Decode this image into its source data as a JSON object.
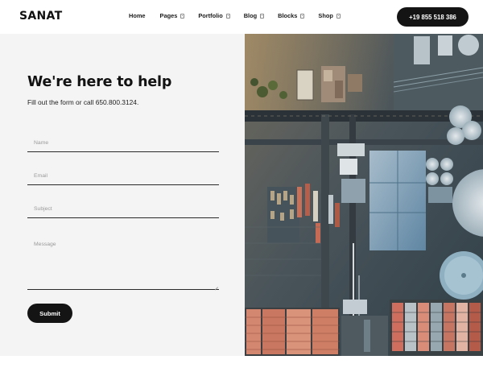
{
  "header": {
    "logo": "SANAT",
    "nav": [
      {
        "label": "Home",
        "has_dropdown": false
      },
      {
        "label": "Pages",
        "has_dropdown": true
      },
      {
        "label": "Portfolio",
        "has_dropdown": true
      },
      {
        "label": "Blog",
        "has_dropdown": true
      },
      {
        "label": "Blocks",
        "has_dropdown": true
      },
      {
        "label": "Shop",
        "has_dropdown": true
      }
    ],
    "phone_button": "+19 855 518 386"
  },
  "contact_form": {
    "title": "We're here to help",
    "subtitle": "Fill out the form or call 650.800.3124.",
    "fields": {
      "name_placeholder": "Name",
      "email_placeholder": "Email",
      "subject_placeholder": "Subject",
      "message_placeholder": "Message"
    },
    "submit_label": "Submit"
  },
  "colors": {
    "button_bg": "#141414",
    "panel_bg": "#f4f4f4",
    "text": "#121212"
  }
}
